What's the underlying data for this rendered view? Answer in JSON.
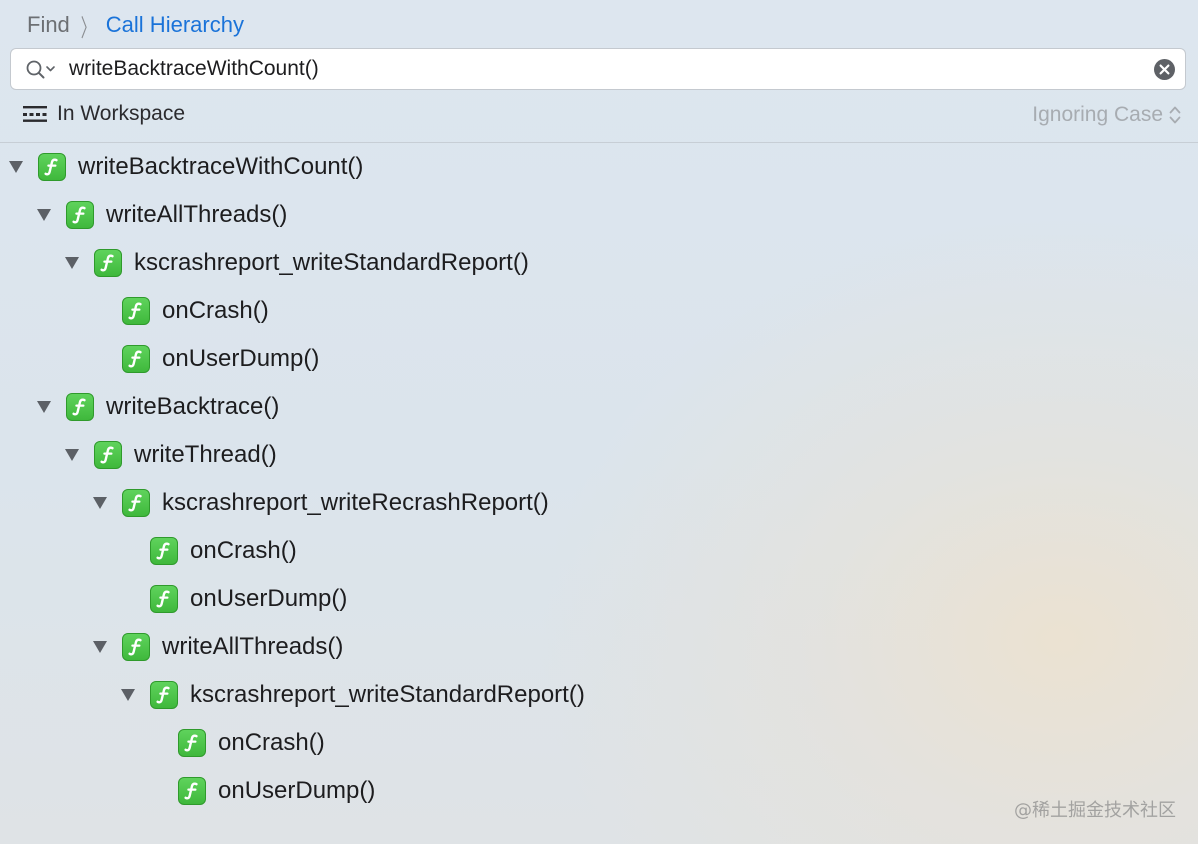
{
  "breadcrumb": {
    "find": "Find",
    "current": "Call Hierarchy"
  },
  "search": {
    "value": "writeBacktraceWithCount()",
    "search_icon": "magnifier-with-dropdown-icon",
    "clear_icon": "clear-circle-x-icon"
  },
  "scope": {
    "icon": "scope-bars-icon",
    "label": "In Workspace"
  },
  "case_option": {
    "label": "Ignoring Case",
    "icon": "updown-chevrons-icon"
  },
  "colors": {
    "accent": "#1a73d9",
    "function_icon": "#4cc449",
    "disabled_text": "#a7acb1"
  },
  "tree": {
    "function_icon_name": "function-f-icon",
    "rows": [
      {
        "depth": 0,
        "expanded": true,
        "label": "writeBacktraceWithCount()"
      },
      {
        "depth": 1,
        "expanded": true,
        "label": "writeAllThreads()"
      },
      {
        "depth": 2,
        "expanded": true,
        "label": "kscrashreport_writeStandardReport()"
      },
      {
        "depth": 3,
        "expanded": null,
        "label": "onCrash()"
      },
      {
        "depth": 3,
        "expanded": null,
        "label": "onUserDump()"
      },
      {
        "depth": 1,
        "expanded": true,
        "label": "writeBacktrace()"
      },
      {
        "depth": 2,
        "expanded": true,
        "label": "writeThread()"
      },
      {
        "depth": 3,
        "expanded": true,
        "label": "kscrashreport_writeRecrashReport()"
      },
      {
        "depth": 4,
        "expanded": null,
        "label": "onCrash()"
      },
      {
        "depth": 4,
        "expanded": null,
        "label": "onUserDump()"
      },
      {
        "depth": 3,
        "expanded": true,
        "label": "writeAllThreads()"
      },
      {
        "depth": 4,
        "expanded": true,
        "label": "kscrashreport_writeStandardReport()"
      },
      {
        "depth": 5,
        "expanded": null,
        "label": "onCrash()"
      },
      {
        "depth": 5,
        "expanded": null,
        "label": "onUserDump()"
      }
    ]
  },
  "watermark": "@稀土掘金技术社区"
}
